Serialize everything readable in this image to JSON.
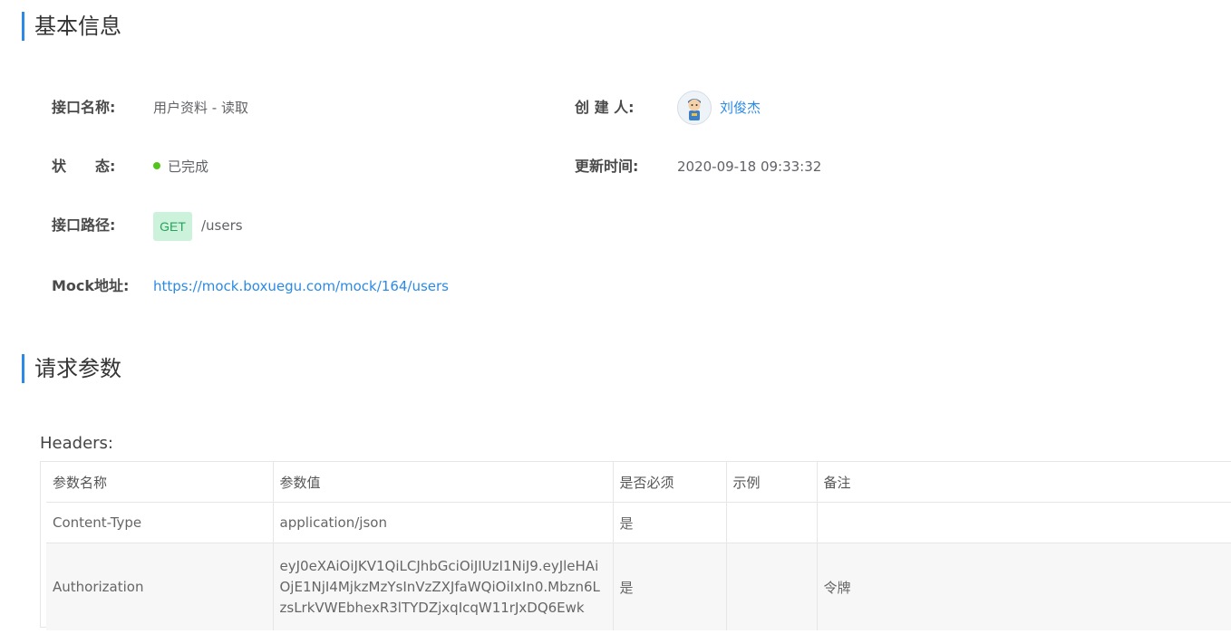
{
  "sections": {
    "basic_info_title": "基本信息",
    "request_params_title": "请求参数"
  },
  "basic": {
    "name_label": "接口名称:",
    "name_value": "用户资料 - 读取",
    "creator_label": "创 建 人:",
    "creator_value": "刘俊杰",
    "status_label": "状　　态:",
    "status_value": "已完成",
    "updated_label": "更新时间:",
    "updated_value": "2020-09-18 09:33:32",
    "path_label": "接口路径:",
    "method": "GET",
    "path_value": "/users",
    "mock_label": "Mock地址:",
    "mock_value": "https://mock.boxuegu.com/mock/164/users"
  },
  "colors": {
    "accent": "#2b8ae5",
    "status_done": "#52c41a",
    "method_bg": "#cdf2dc",
    "method_text": "#27a25a"
  },
  "headers": {
    "label": "Headers:",
    "columns": [
      "参数名称",
      "参数值",
      "是否必须",
      "示例",
      "备注"
    ],
    "rows": [
      {
        "name": "Content-Type",
        "value": "application/json",
        "required": "是",
        "example": "",
        "remark": ""
      },
      {
        "name": "Authorization",
        "value": "eyJ0eXAiOiJKV1QiLCJhbGciOiJIUzI1NiJ9.eyJleHAiOjE1NjI4MjkzMzYsInVzZXJfaWQiOiIxIn0.Mbzn6LzsLrkVWEbhexR3lTYDZjxqIcqW11rJxDQ6Ewk",
        "required": "是",
        "example": "",
        "remark": "令牌"
      }
    ]
  },
  "icons": {
    "avatar": "user-avatar-icon",
    "status": "status-dot-icon"
  }
}
